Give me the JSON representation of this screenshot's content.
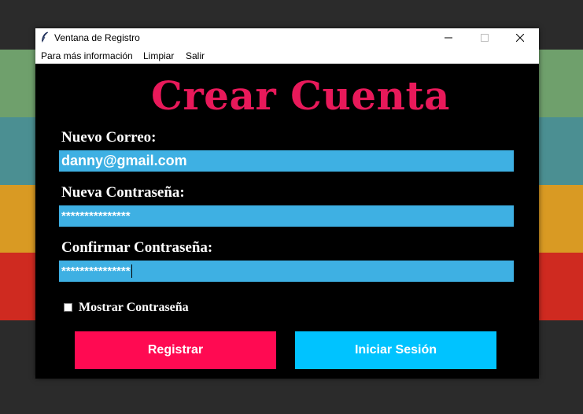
{
  "window": {
    "title": "Ventana de Registro",
    "icon": "feather-icon",
    "controls": [
      "minimize-icon",
      "maximize-icon",
      "close-icon"
    ]
  },
  "menu": {
    "items": [
      "Para más información",
      "Limpiar",
      "Salir"
    ]
  },
  "form": {
    "heading": "Crear Cuenta",
    "email_label": "Nuevo Correo:",
    "email_value": "danny@gmail.com",
    "password_label": "Nueva Contraseña:",
    "password_value": "***************",
    "confirm_label": "Confirmar Contraseña:",
    "confirm_value": "***************",
    "show_password_label": "Mostrar Contraseña",
    "show_password_checked": false
  },
  "buttons": {
    "register": "Registrar",
    "login": "Iniciar Sesión"
  },
  "colors": {
    "heading": "#e8195a",
    "field_bg": "#3eb0e3",
    "register_bg": "#ff0a52",
    "login_bg": "#00c3ff",
    "window_bg": "#000000",
    "background_stripes": [
      "#6fa06c",
      "#4b8f92",
      "#d99a23",
      "#cf2a20"
    ]
  }
}
